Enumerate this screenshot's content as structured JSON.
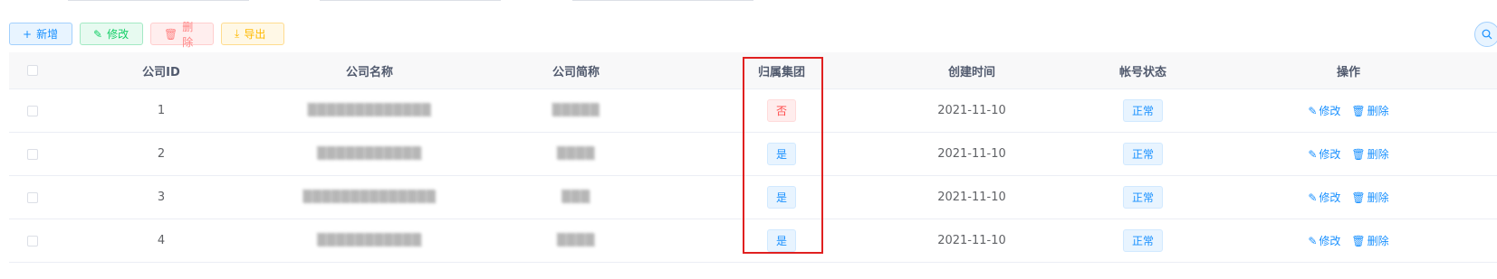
{
  "toolbar": {
    "add_label": "新增",
    "edit_label": "修改",
    "delete_label": "删除",
    "export_label": "导出"
  },
  "icons": {
    "add": "plus-icon",
    "edit": "edit-icon",
    "delete": "trash-icon",
    "export": "download-icon",
    "search": "search-icon"
  },
  "colors": {
    "primary": "#1890ff",
    "success": "#13ce66",
    "danger": "#ff4949",
    "warning": "#ffba00",
    "highlight": "#e02020"
  },
  "table": {
    "headers": {
      "company_id": "公司ID",
      "company_name": "公司名称",
      "company_short": "公司简称",
      "group": "归属集团",
      "created": "创建时间",
      "status": "帐号状态",
      "actions": "操作"
    },
    "rows": [
      {
        "id": "1",
        "name": "▒▒▒▒▒▒▒▒▒▒▒▒▒",
        "short": "▒▒▒▒▒",
        "group": "否",
        "created": "2021-11-10",
        "status": "正常",
        "edit": "修改",
        "delete": "删除"
      },
      {
        "id": "2",
        "name": "▒▒▒▒▒▒▒▒▒▒▒",
        "short": "▒▒▒▒",
        "group": "是",
        "created": "2021-11-10",
        "status": "正常",
        "edit": "修改",
        "delete": "删除"
      },
      {
        "id": "3",
        "name": "▒▒▒▒▒▒▒▒▒▒▒▒▒▒",
        "short": "▒▒▒",
        "group": "是",
        "created": "2021-11-10",
        "status": "正常",
        "edit": "修改",
        "delete": "删除"
      },
      {
        "id": "4",
        "name": "▒▒▒▒▒▒▒▒▒▒▒",
        "short": "▒▒▒▒",
        "group": "是",
        "created": "2021-11-10",
        "status": "正常",
        "edit": "修改",
        "delete": "删除"
      }
    ]
  }
}
